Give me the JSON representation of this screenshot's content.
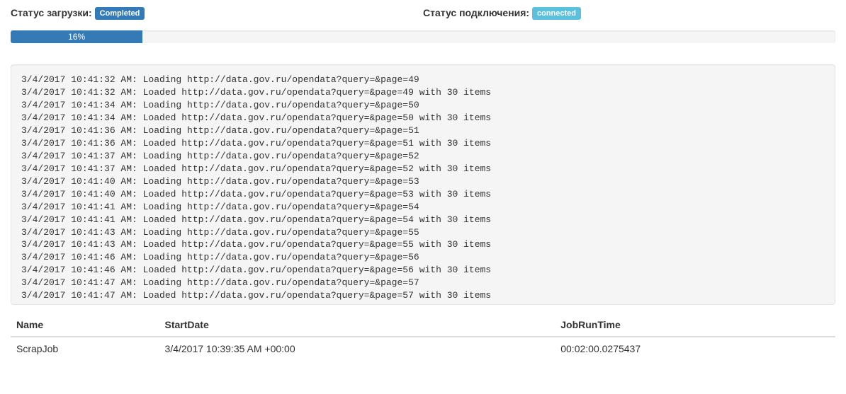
{
  "status": {
    "load_label": "Статус загрузки:",
    "load_badge": "Completed",
    "conn_label": "Статус подключения:",
    "conn_badge": "connected"
  },
  "progress": {
    "percent": "16%",
    "width": "16%"
  },
  "log_lines": [
    "3/4/2017 10:41:32 AM: Loading http://data.gov.ru/opendata?query=&page=49",
    "3/4/2017 10:41:32 AM: Loaded http://data.gov.ru/opendata?query=&page=49 with 30 items",
    "3/4/2017 10:41:34 AM: Loading http://data.gov.ru/opendata?query=&page=50",
    "3/4/2017 10:41:34 AM: Loaded http://data.gov.ru/opendata?query=&page=50 with 30 items",
    "3/4/2017 10:41:36 AM: Loading http://data.gov.ru/opendata?query=&page=51",
    "3/4/2017 10:41:36 AM: Loaded http://data.gov.ru/opendata?query=&page=51 with 30 items",
    "3/4/2017 10:41:37 AM: Loading http://data.gov.ru/opendata?query=&page=52",
    "3/4/2017 10:41:37 AM: Loaded http://data.gov.ru/opendata?query=&page=52 with 30 items",
    "3/4/2017 10:41:40 AM: Loading http://data.gov.ru/opendata?query=&page=53",
    "3/4/2017 10:41:40 AM: Loaded http://data.gov.ru/opendata?query=&page=53 with 30 items",
    "3/4/2017 10:41:41 AM: Loading http://data.gov.ru/opendata?query=&page=54",
    "3/4/2017 10:41:41 AM: Loaded http://data.gov.ru/opendata?query=&page=54 with 30 items",
    "3/4/2017 10:41:43 AM: Loading http://data.gov.ru/opendata?query=&page=55",
    "3/4/2017 10:41:43 AM: Loaded http://data.gov.ru/opendata?query=&page=55 with 30 items",
    "3/4/2017 10:41:46 AM: Loading http://data.gov.ru/opendata?query=&page=56",
    "3/4/2017 10:41:46 AM: Loaded http://data.gov.ru/opendata?query=&page=56 with 30 items",
    "3/4/2017 10:41:47 AM: Loading http://data.gov.ru/opendata?query=&page=57",
    "3/4/2017 10:41:47 AM: Loaded http://data.gov.ru/opendata?query=&page=57 with 30 items"
  ],
  "table": {
    "headers": {
      "name": "Name",
      "start": "StartDate",
      "runtime": "JobRunTime"
    },
    "rows": [
      {
        "name": "ScrapJob",
        "start": "3/4/2017 10:39:35 AM +00:00",
        "runtime": "00:02:00.0275437"
      }
    ]
  }
}
